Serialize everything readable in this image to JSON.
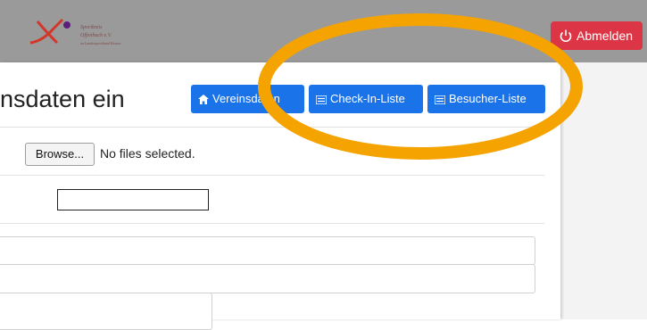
{
  "header": {
    "logo_lines": [
      "Sportkreis",
      "Offenbach e.V.",
      "im Landessportbund Hessen"
    ],
    "logout_label": "Abmelden"
  },
  "page": {
    "title": "nsdaten ein"
  },
  "toolbar": {
    "vereinsdaten_label": "Vereinsdaten",
    "checkin_label": "Check-In-Liste",
    "besucher_label": "Besucher-Liste"
  },
  "upload": {
    "browse_label": "Browse...",
    "status": "No files selected."
  },
  "colors": {
    "header_bg": "#9a9a9a",
    "primary": "#1a73e8",
    "danger": "#dc3545",
    "highlight_ring": "#f5a300"
  }
}
